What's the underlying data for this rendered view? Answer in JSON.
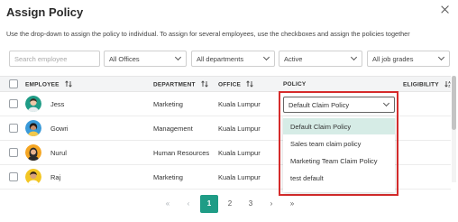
{
  "dialog": {
    "title": "Assign Policy",
    "subtitle": "Use the drop-down to assign the policy to individual. To assign for several employees, use the checkboxes and assign the policies together"
  },
  "filters": {
    "search_placeholder": "Search employee",
    "offices": "All Offices",
    "departments": "All departments",
    "status": "Active",
    "job_grades": "All job grades"
  },
  "columns": {
    "employee": "EMPLOYEE",
    "department": "DEPARTMENT",
    "office": "OFFICE",
    "policy": "POLICY",
    "eligibility": "ELIGIBILITY"
  },
  "rows": [
    {
      "name": "Jess",
      "department": "Marketing",
      "office": "Kuala Lumpur"
    },
    {
      "name": "Gowri",
      "department": "Management",
      "office": "Kuala Lumpur"
    },
    {
      "name": "Nurul",
      "department": "Human Resources",
      "office": "Kuala Lumpur"
    },
    {
      "name": "Raj",
      "department": "Marketing",
      "office": "Kuala Lumpur"
    }
  ],
  "policy_select": {
    "value": "Default Claim Policy",
    "options": [
      "Default Claim Policy",
      "Sales team claim policy",
      "Marketing Team Claim Policy",
      "test default"
    ]
  },
  "pagination": {
    "first": "«",
    "prev": "‹",
    "pages": [
      "1",
      "2",
      "3"
    ],
    "current_page": "1",
    "next": "›",
    "last": "»"
  },
  "colors": {
    "accent": "#1f9c86",
    "highlight_border": "#d62c2c",
    "selected_option_bg": "#d6ece6"
  }
}
